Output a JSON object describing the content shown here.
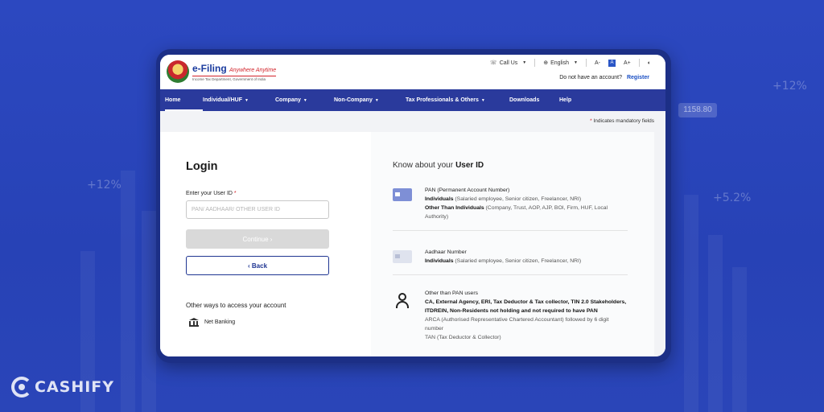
{
  "brand": {
    "name": "e-Filing",
    "tagline": "Anywhere Anytime",
    "subtitle": "Income Tax Department, Government of India"
  },
  "header": {
    "call_us": "Call Us",
    "language": "English",
    "font_decrease": "A-",
    "font_default": "A",
    "font_increase": "A+",
    "no_account_text": "Do not have an account?",
    "register_label": "Register"
  },
  "nav": {
    "items": [
      {
        "label": "Home",
        "active": true
      },
      {
        "label": "Individual/HUF",
        "dropdown": true
      },
      {
        "label": "Company",
        "dropdown": true
      },
      {
        "label": "Non-Company",
        "dropdown": true
      },
      {
        "label": "Tax Professionals & Others",
        "dropdown": true
      },
      {
        "label": "Downloads"
      },
      {
        "label": "Help"
      }
    ]
  },
  "mandatory_note": "Indicates mandatory fields",
  "login": {
    "title": "Login",
    "user_id_label": "Enter your User ID",
    "user_id_placeholder": "PAN/ AADHAAR/ OTHER USER ID",
    "user_id_value": "",
    "continue_label": "Continue",
    "back_label": "Back",
    "other_ways": "Other ways to access your account",
    "net_banking": "Net Banking"
  },
  "know": {
    "title_prefix": "Know about your",
    "title_bold": "User ID",
    "items": [
      {
        "icon": "pan-card-icon",
        "title": "PAN (Permanent Account Number)",
        "line1_bold": "Individuals",
        "line1_rest": "(Salaried employee, Senior citizen, Freelancer, NRI)",
        "line2_bold": "Other Than Individuals",
        "line2_rest": "(Company, Trust, AOP, AJP, BOI, Firm, HUF, Local Authority)"
      },
      {
        "icon": "aadhaar-card-icon",
        "title": "Aadhaar Number",
        "line1_bold": "Individuals",
        "line1_rest": "(Salaried employee, Senior citizen, Freelancer, NRI)"
      },
      {
        "icon": "user-icon",
        "title": "Other than PAN users",
        "line1_bold": "CA, External Agency, ERI, Tax Deductor & Tax collector, TIN 2.0 Stakeholders, ITDREIN, Non-Residents not holding and not required to have PAN",
        "line2_rest": "ARCA (Authorised Representative Chartered Accountant) followed by 6 digit number",
        "line3_rest": "TAN (Tax Deductor & Collector)"
      }
    ]
  },
  "background": {
    "numbers": [
      "+12%",
      "+12%",
      "+5.2%",
      "1158.80"
    ],
    "watermark": "CASHIFY"
  }
}
